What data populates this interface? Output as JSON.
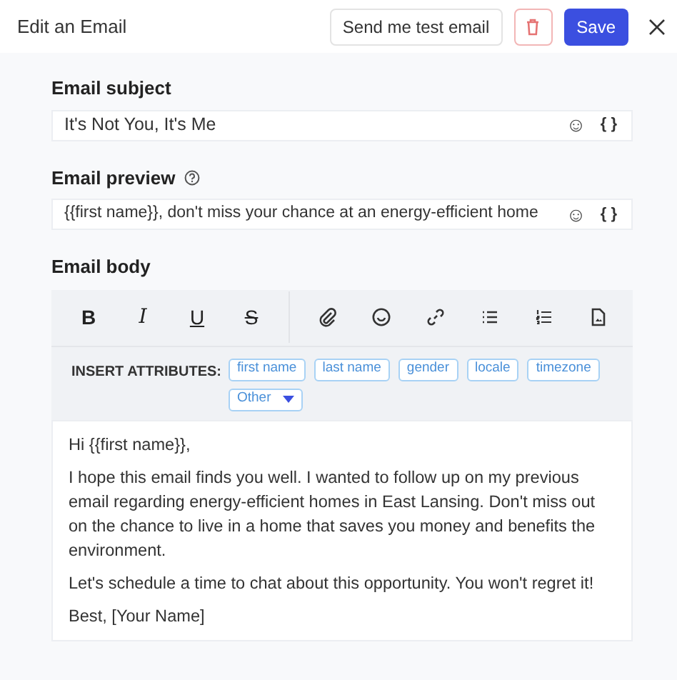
{
  "header": {
    "title": "Edit an Email",
    "test_button": "Send me test email",
    "save_button": "Save"
  },
  "subject": {
    "label": "Email subject",
    "value": "It's Not You, It's Me",
    "emoji": "☺",
    "braces": "{ }"
  },
  "preview": {
    "label": "Email preview",
    "value": "{{first name}}, don't miss your chance at an energy-efficient home",
    "emoji": "☺",
    "braces": "{ }"
  },
  "body": {
    "label": "Email body",
    "toolbar": [
      {
        "kind": "bold",
        "glyph": "B"
      },
      {
        "kind": "italic",
        "glyph": "I"
      },
      {
        "kind": "underline",
        "glyph": "U"
      },
      {
        "kind": "strike",
        "glyph": "S"
      },
      {
        "kind": "attach"
      },
      {
        "kind": "emoji"
      },
      {
        "kind": "link"
      },
      {
        "kind": "bullets"
      },
      {
        "kind": "numbers"
      },
      {
        "kind": "file"
      }
    ],
    "attributes_label": "INSERT ATTRIBUTES:",
    "attributes": [
      {
        "label": "first name",
        "kind": "tag"
      },
      {
        "label": "last name",
        "kind": "tag"
      },
      {
        "label": "gender",
        "kind": "tag"
      },
      {
        "label": "locale",
        "kind": "tag"
      },
      {
        "label": "timezone",
        "kind": "tag"
      },
      {
        "label": "Other",
        "kind": "dropdown"
      }
    ],
    "paragraphs": [
      "Hi {{first name}},",
      "I hope this email finds you well. I wanted to follow up on my previous email regarding energy-efficient homes in East Lansing. Don't miss out on the chance to live in a home that saves you money and benefits the environment.",
      "Let's schedule a time to chat about this opportunity. You won't regret it!",
      "Best, [Your Name]"
    ]
  }
}
